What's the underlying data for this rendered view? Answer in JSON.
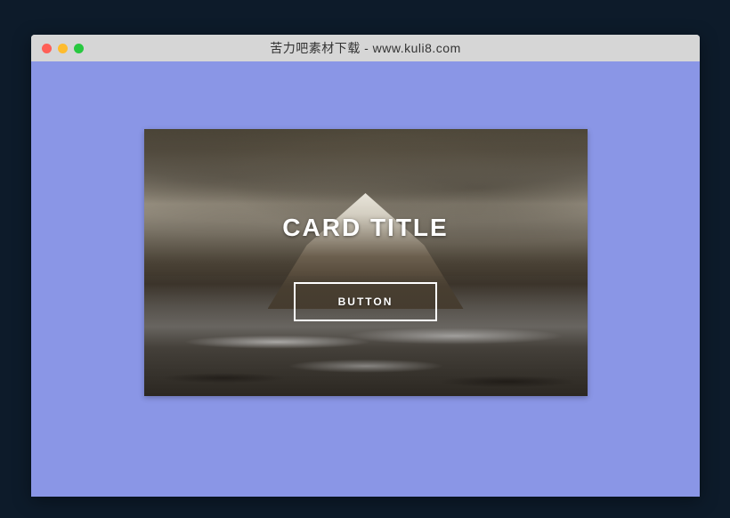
{
  "window": {
    "title": "苦力吧素材下载 - www.kuli8.com"
  },
  "card": {
    "title": "CARD TITLE",
    "button_label": "BUTTON"
  }
}
